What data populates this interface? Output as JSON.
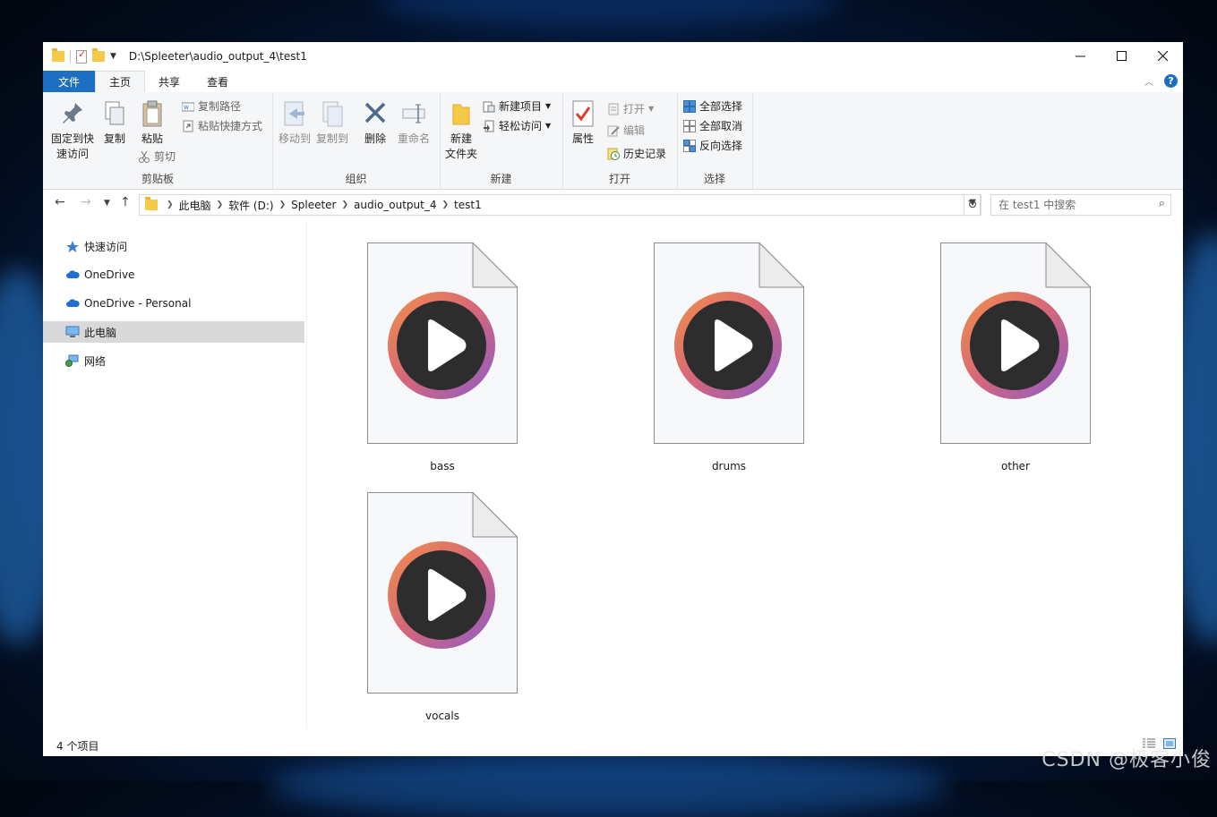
{
  "window": {
    "title": "D:\\Spleeter\\audio_output_4\\test1"
  },
  "tabs": [
    {
      "label": "文件"
    },
    {
      "label": "主页"
    },
    {
      "label": "共享"
    },
    {
      "label": "查看"
    }
  ],
  "ribbon": {
    "clipboard": {
      "group_label": "剪贴板",
      "pin_line1": "固定到快",
      "pin_line2": "速访问",
      "copy": "复制",
      "paste": "粘贴",
      "copy_path": "复制路径",
      "paste_shortcut": "粘贴快捷方式",
      "cut": "剪切"
    },
    "organize": {
      "group_label": "组织",
      "move_to": "移动到",
      "copy_to": "复制到",
      "delete": "删除",
      "rename": "重命名"
    },
    "new": {
      "group_label": "新建",
      "new_folder_line1": "新建",
      "new_folder_line2": "文件夹",
      "new_item": "新建项目",
      "easy_access": "轻松访问"
    },
    "open": {
      "group_label": "打开",
      "properties": "属性",
      "open": "打开",
      "edit": "编辑",
      "history": "历史记录"
    },
    "select": {
      "group_label": "选择",
      "select_all": "全部选择",
      "select_none": "全部取消",
      "invert": "反向选择"
    }
  },
  "address": {
    "crumbs": [
      "此电脑",
      "软件 (D:)",
      "Spleeter",
      "audio_output_4",
      "test1"
    ],
    "search_placeholder": "在 test1 中搜索"
  },
  "sidebar": {
    "items": [
      {
        "label": "快速访问",
        "icon": "star-icon"
      },
      {
        "label": "OneDrive",
        "icon": "cloud-icon"
      },
      {
        "label": "OneDrive - Personal",
        "icon": "cloud-icon"
      },
      {
        "label": "此电脑",
        "icon": "computer-icon"
      },
      {
        "label": "网络",
        "icon": "network-icon"
      }
    ]
  },
  "files": [
    {
      "name": "bass"
    },
    {
      "name": "drums"
    },
    {
      "name": "other"
    },
    {
      "name": "vocals"
    }
  ],
  "status": {
    "count": "4 个项目"
  },
  "watermark": "CSDN @极客小俊",
  "colors": {
    "accent": "#1c6fc1",
    "selected": "#d9d9d9",
    "play_ring_start": "#f08a4b",
    "play_ring_end": "#8e5cc9"
  }
}
